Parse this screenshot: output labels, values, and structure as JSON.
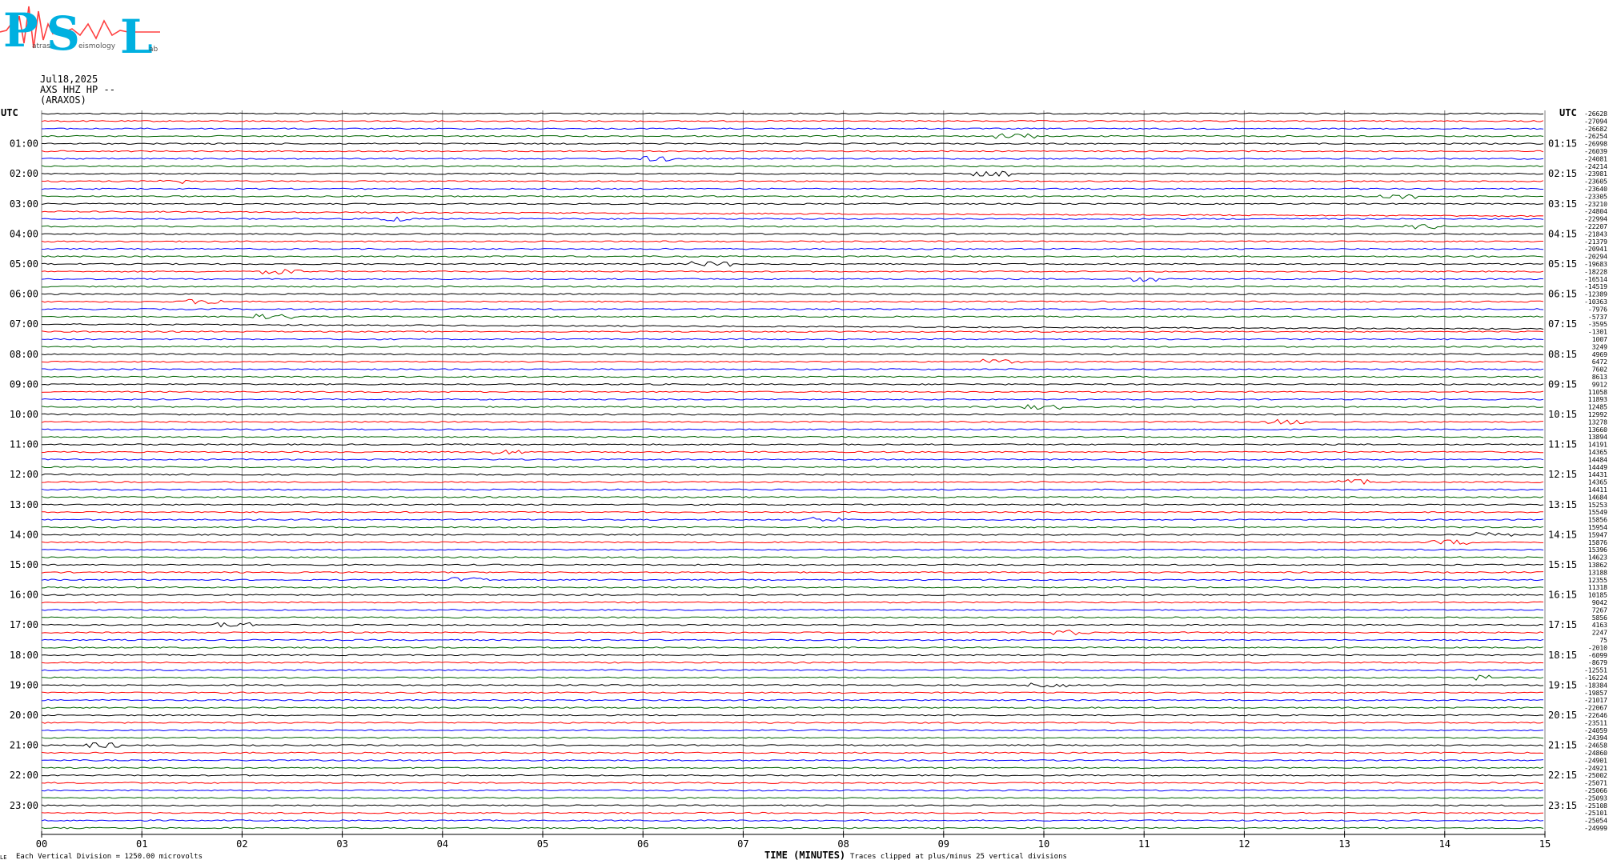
{
  "header": {
    "logo_text": "PSL",
    "logo_subtext": "Patras Seismology Lab",
    "date": "Jul18,2025",
    "station": "AXS HHZ HP --",
    "site": "(ARAXOS)"
  },
  "chart_data": {
    "type": "line",
    "title": "",
    "xlabel": "TIME (MINUTES)",
    "ylabel": "",
    "x_range": [
      0,
      15
    ],
    "x_ticks": [
      "00",
      "01",
      "02",
      "03",
      "04",
      "05",
      "06",
      "07",
      "08",
      "09",
      "10",
      "11",
      "12",
      "13",
      "14",
      "15"
    ],
    "left_corner_label": "UTC",
    "right_corner_label": "UTC",
    "left_hour_labels": [
      "01:00",
      "02:00",
      "03:00",
      "04:00",
      "05:00",
      "06:00",
      "07:00",
      "08:00",
      "09:00",
      "10:00",
      "11:00",
      "12:00",
      "13:00",
      "14:00",
      "15:00",
      "16:00",
      "17:00",
      "18:00",
      "19:00",
      "20:00",
      "21:00",
      "22:00",
      "23:00"
    ],
    "right_hour_labels": [
      "01:15",
      "02:15",
      "03:15",
      "04:15",
      "05:15",
      "06:15",
      "07:15",
      "08:15",
      "09:15",
      "10:15",
      "11:15",
      "12:15",
      "13:15",
      "14:15",
      "15:15",
      "16:15",
      "17:15",
      "18:15",
      "19:15",
      "20:15",
      "21:15",
      "22:15",
      "23:15"
    ],
    "trace_colors": [
      "#000000",
      "#ff0000",
      "#0000ff",
      "#006400"
    ],
    "trace_offsets": [
      "-26628",
      "-27094",
      "-26682",
      "-26254",
      "-26998",
      "-26039",
      "-24081",
      "-24214",
      "-23981",
      "-23605",
      "-23640",
      "-23305",
      "-23210",
      "-24804",
      "-22994",
      "-22207",
      "-21843",
      "-21379",
      "-20941",
      "-20294",
      "-19683",
      "-18228",
      "-16514",
      "-14519",
      "-12389",
      "-10363",
      "-7976",
      "-5737",
      "-3595",
      "-1301",
      "1007",
      "3249",
      "4969",
      "6472",
      "7602",
      "8613",
      "9912",
      "11058",
      "11893",
      "12485",
      "12992",
      "13278",
      "13660",
      "13894",
      "14191",
      "14365",
      "14484",
      "14449",
      "14431",
      "14365",
      "14411",
      "14684",
      "15253",
      "15549",
      "15856",
      "15954",
      "15947",
      "15876",
      "15396",
      "14623",
      "13862",
      "13188",
      "12355",
      "11318",
      "10185",
      "9042",
      "7267",
      "5856",
      "4163",
      "2247",
      "75",
      "-2010",
      "-6099",
      "-8679",
      "-12551",
      "-16224",
      "-18384",
      "-19857",
      "-21017",
      "-22067",
      "-22646",
      "-23511",
      "-24059",
      "-24394",
      "-24658",
      "-24860",
      "-24901",
      "-24921",
      "-25002",
      "-25071",
      "-25066",
      "-25093",
      "-25108",
      "-25101",
      "-25054",
      "-24999"
    ],
    "grid": true
  },
  "footer": {
    "left_note": "Each Vertical Division = 1250.00 microvolts",
    "right_note": "Traces clipped at plus/minus 25 vertical divisions",
    "corner_mark": "LE"
  }
}
